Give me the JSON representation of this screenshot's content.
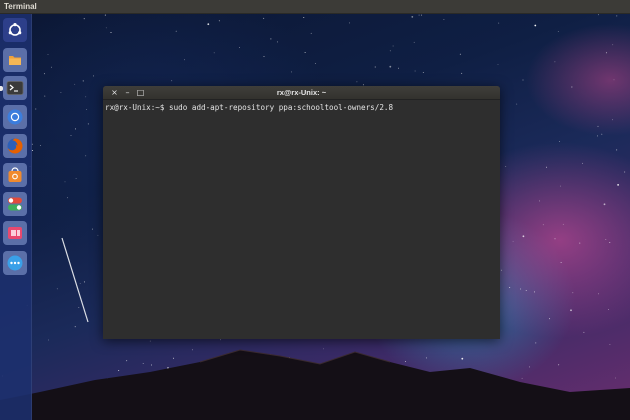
{
  "top_panel": {
    "app_title": "Terminal"
  },
  "launcher": {
    "items": [
      {
        "name": "ubuntu-dash",
        "icon": "ubuntu-logo-icon",
        "color": "#2d3f8a",
        "running": false
      },
      {
        "name": "files",
        "icon": "folder-icon",
        "color": "#f0a13a",
        "running": false
      },
      {
        "name": "terminal",
        "icon": "terminal-icon",
        "color": "#3a3a3a",
        "running": true
      },
      {
        "name": "chromium",
        "icon": "chromium-icon",
        "color": "#3b7ddd",
        "running": false
      },
      {
        "name": "firefox",
        "icon": "firefox-icon",
        "color": "#e66000",
        "running": false
      },
      {
        "name": "software-center",
        "icon": "shopping-bag-icon",
        "color": "#f08a2e",
        "running": false
      },
      {
        "name": "settings",
        "icon": "toggle-icon",
        "color": "#3fae5c",
        "running": false
      },
      {
        "name": "office",
        "icon": "document-icon",
        "color": "#e8496f",
        "running": false
      },
      {
        "name": "show-apps",
        "icon": "more-apps-icon",
        "color": "#3aa0e8",
        "running": false
      }
    ]
  },
  "terminal": {
    "window_title": "rx@rx-Unix: ~",
    "buttons": {
      "close": "×",
      "minimize": "–",
      "maximize": "□"
    },
    "prompt": "rx@rx-Unix:~$",
    "command": "sudo add-apt-repository ppa:schooltool-owners/2.8"
  },
  "colors": {
    "panel": "#3c3b37",
    "launcher": "#1c306e",
    "terminal_bg": "#2e2e2e",
    "terminal_text": "#e4e4e4"
  }
}
